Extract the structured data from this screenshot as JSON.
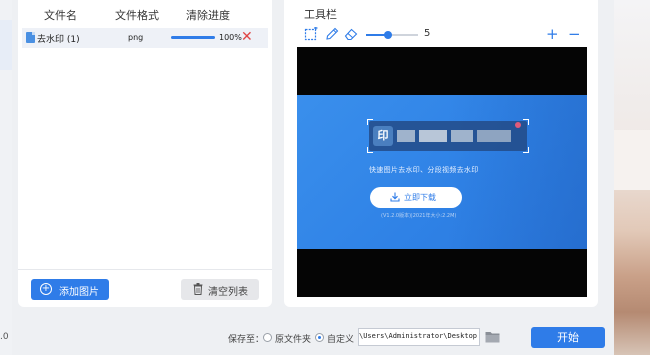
{
  "file_list": {
    "columns": [
      "文件名",
      "文件格式",
      "清除进度"
    ],
    "rows": [
      {
        "name": "去水印 (1)",
        "format": "png",
        "progress": 100,
        "progress_label": "100%"
      }
    ],
    "add_button": "添加图片",
    "clear_button": "清空列表"
  },
  "toolbar": {
    "title": "工具栏",
    "brush_size": 5,
    "brush_size_label": "5",
    "brush_size_fraction": 0.42,
    "zoom_in": "+",
    "zoom_out": "−"
  },
  "preview": {
    "logo_char": "印",
    "tagline": "快速图片去水印、分段视频去水印",
    "download_button": "立即下载",
    "version_note": "(V1.2.0版本)|2021年大小:2.2M)"
  },
  "bottom": {
    "version_fragment": ".0",
    "save_to_label": "保存至：",
    "option_source": "原文件夹",
    "option_custom": "自定义",
    "selected": "custom",
    "path": "C:\\Users\\Administrator\\Desktop",
    "start_button": "开始"
  },
  "colors": {
    "accent": "#2f7ce8",
    "delete": "#e04545",
    "preview_blue": "#2f82e6"
  }
}
